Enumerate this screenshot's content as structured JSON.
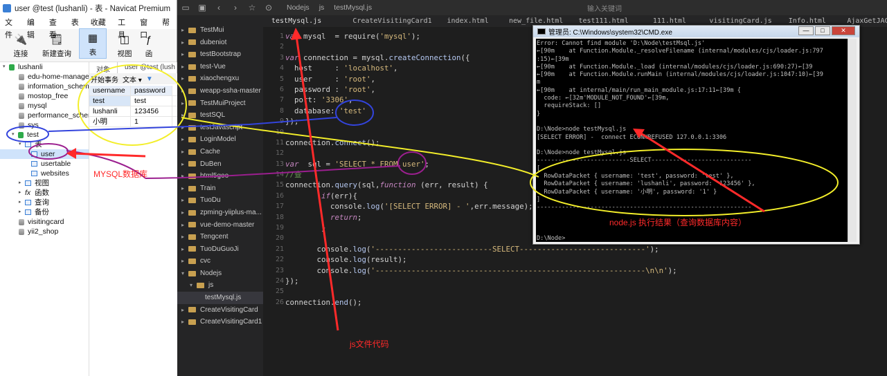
{
  "navicat": {
    "window_title": "user @test (lushanli) - 表 - Navicat Premium",
    "menu": [
      "文件",
      "编辑",
      "查看",
      "表",
      "收藏夹",
      "工具",
      "窗口",
      "帮"
    ],
    "toolbar": [
      {
        "label": "连接",
        "icon": "plug-icon"
      },
      {
        "label": "新建查询",
        "icon": "query-icon"
      },
      {
        "label": "表",
        "icon": "table-icon"
      },
      {
        "label": "视图",
        "icon": "view-icon"
      },
      {
        "label": "函",
        "icon": "function-icon"
      }
    ],
    "tree": [
      {
        "label": "lushanli",
        "kind": "connection"
      },
      {
        "label": "edu-home-manage",
        "kind": "db"
      },
      {
        "label": "information_schema",
        "kind": "db"
      },
      {
        "label": "mostop_free",
        "kind": "db"
      },
      {
        "label": "mysql",
        "kind": "db"
      },
      {
        "label": "performance_schema",
        "kind": "db"
      },
      {
        "label": "sys",
        "kind": "db"
      },
      {
        "label": "test",
        "kind": "db-open"
      },
      {
        "label": "表",
        "kind": "group"
      },
      {
        "label": "user",
        "kind": "table"
      },
      {
        "label": "usertable",
        "kind": "table"
      },
      {
        "label": "websites",
        "kind": "table"
      },
      {
        "label": "视图",
        "kind": "group"
      },
      {
        "label": "函数",
        "kind": "group"
      },
      {
        "label": "查询",
        "kind": "group"
      },
      {
        "label": "备份",
        "kind": "group"
      },
      {
        "label": "visitingcard",
        "kind": "db"
      },
      {
        "label": "yii2_shop",
        "kind": "db"
      }
    ],
    "object_tabs": [
      "对象",
      "user @test (lush"
    ],
    "object_toolbar": [
      "开始事务",
      "文本 ▾",
      "▼"
    ],
    "grid": {
      "columns": [
        "username",
        "password"
      ],
      "rows": [
        [
          "test",
          "test"
        ],
        [
          "lushanli",
          "123456"
        ],
        [
          "小明",
          "1"
        ]
      ]
    }
  },
  "editor": {
    "topbar_crumbs": [
      "Nodejs",
      "js",
      "testMysql.js"
    ],
    "search_placeholder": "输入关键词",
    "tabs": [
      "testMysql.js",
      "CreateVisitingCard1",
      "index.html",
      "new_file.html",
      "test111.html",
      "111.html",
      "visitingCard.js",
      "Info.html",
      "AjaxGetJAC"
    ],
    "explorer": [
      {
        "label": "TestMui",
        "open": false
      },
      {
        "label": "dubeniot",
        "open": false
      },
      {
        "label": "testBootstrap",
        "open": false
      },
      {
        "label": "test-Vue",
        "open": false
      },
      {
        "label": "xiaochengxu",
        "open": false
      },
      {
        "label": "weapp-ssha-master",
        "open": false
      },
      {
        "label": "TestMuiProject",
        "open": false
      },
      {
        "label": "testSQL",
        "open": false
      },
      {
        "label": "testJavascript",
        "open": false
      },
      {
        "label": "LoginModel",
        "open": false
      },
      {
        "label": "Cache",
        "open": false
      },
      {
        "label": "DuBen",
        "open": false
      },
      {
        "label": "html5geo",
        "open": false
      },
      {
        "label": "Train",
        "open": false
      },
      {
        "label": "TuoDu",
        "open": false
      },
      {
        "label": "zpming-yiiplus-ma...",
        "open": false
      },
      {
        "label": "vue-demo-master",
        "open": false
      },
      {
        "label": "Tengcent",
        "open": false
      },
      {
        "label": "TuoDuGuoJi",
        "open": false
      },
      {
        "label": "cvc",
        "open": false
      },
      {
        "label": "Nodejs",
        "open": true
      },
      {
        "label": "js",
        "open": true
      },
      {
        "label": "testMysql.js",
        "open": null
      },
      {
        "label": "CreateVisitingCard",
        "open": false
      },
      {
        "label": "CreateVisitingCard1",
        "open": false
      }
    ],
    "line_numbers": [
      "1",
      "2",
      "3",
      "4",
      "5",
      "6",
      "7",
      "8",
      "9",
      "10",
      "11",
      "12",
      "13",
      "14",
      "15",
      "16",
      "17",
      "18",
      "19",
      "20",
      "21",
      "22",
      "23",
      "24",
      "25",
      "26"
    ],
    "code": [
      "var mysql  = require('mysql');",
      "",
      "var connection = mysql.createConnection({",
      "  host     : 'localhost',",
      "  user     : 'root',",
      "  password : 'root',",
      "  port: '3306',",
      "  database: 'test'",
      "});",
      "",
      "connection.connect();",
      "",
      "var  sql = 'SELECT * FROM user';",
      "//查",
      "connection.query(sql,function (err, result) {",
      "        if(err){",
      "          console.log('[SELECT ERROR] - ',err.message);",
      "          return;",
      "        }",
      "",
      "       console.log('--------------------------SELECT----------------------------');",
      "       console.log(result);",
      "       console.log('------------------------------------------------------------\\n\\n');",
      "});",
      "",
      "connection.end();"
    ]
  },
  "cmd": {
    "title": "管理员: C:\\Windows\\system32\\CMD.exe",
    "buttons": [
      "—",
      "□",
      "✕"
    ],
    "lines": [
      "Error: Cannot find module 'D:\\Node\\testMsql.js'",
      "←[90m    at Function.Module._resolveFilename (internal/modules/cjs/loader.js:797",
      ":15)←[39m",
      "←[90m    at Function.Module._load (internal/modules/cjs/loader.js:690:27)←[39",
      "←[90m    at Function.Module.runMain (internal/modules/cjs/loader.js:1047:10)←[39",
      "m",
      "←[90m    at internal/main/run_main_module.js:17:11←[39m {",
      "  code: ←[32m'MODULE_NOT_FOUND'←[39m,",
      "  requireStack: []",
      "}",
      "",
      "D:\\Node>node testMysql.js",
      "[SELECT ERROR] -  connect ECONNREFUSED 127.0.0.1:3306",
      "",
      "D:\\Node>node testMysql.js",
      "--------------------------SELECT----------------------------",
      "[",
      "  RowDataPacket { username: 'test', password: 'test' },",
      "  RowDataPacket { username: 'lushanli', password: '123456' },",
      "  RowDataPacket { username: '小明', password: '1' }",
      "]",
      "------------------------------------------------------------",
      "",
      "",
      "",
      "D:\\Node>"
    ]
  },
  "annotations": {
    "mysql_db": "MYSQL数据库",
    "node_result": "node.js 执行结果（查询数据库内容）",
    "js_file": "js文件代码",
    "color": "#ff2a2a"
  }
}
